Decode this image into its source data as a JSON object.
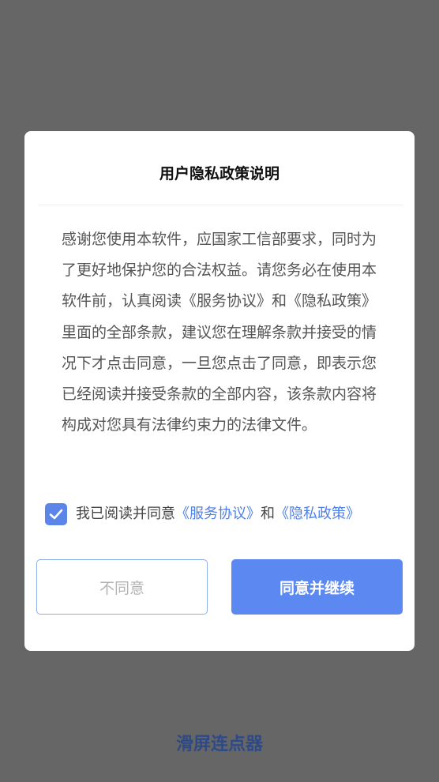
{
  "app": {
    "name": "滑屏连点器"
  },
  "dialog": {
    "title": "用户隐私政策说明",
    "body": "感谢您使用本软件，应国家工信部要求，同时为了更好地保护您的合法权益。请您务必在使用本软件前，认真阅读《服务协议》和《隐私政策》里面的全部条款，建议您在理解条款并接受的情况下才点击同意，一旦您点击了同意，即表示您已经阅读并接受条款的全部内容，该条款内容将构成对您具有法律约束力的法律文件。",
    "agree_row": {
      "checked": true,
      "prefix": "我已阅读并同意",
      "service_link": "《服务协议》",
      "conjunction": "和",
      "privacy_link": "《隐私政策》"
    },
    "buttons": {
      "disagree": "不同意",
      "agree": "同意并继续"
    }
  },
  "colors": {
    "accent": "#5b89f1",
    "link": "#4f80e8",
    "backdrop": "#666666",
    "app_name": "#2e4a86"
  }
}
